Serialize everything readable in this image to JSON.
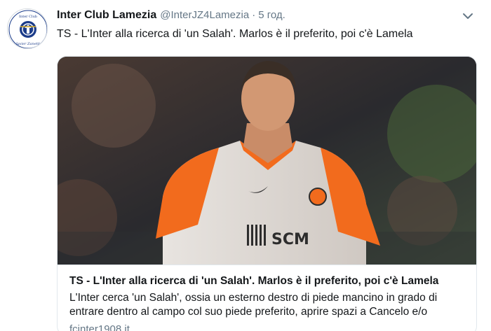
{
  "user": {
    "name": "Inter Club Lamezia",
    "handle": "@InterJZ4Lamezia",
    "separator": "·",
    "time": "5 год.",
    "avatar_text": {
      "top": "Inter Club",
      "bottom": "Javier Zanetti"
    }
  },
  "tweet": {
    "text": "TS - L'Inter alla ricerca di 'un Salah'. Marlos è il preferito, poi c'è Lamela"
  },
  "card": {
    "image_logo_text": "SCM",
    "title": "TS - L'Inter alla ricerca di 'un Salah'. Marlos è il preferito, poi c'è Lamela",
    "description": "L'Inter cerca 'un Salah', ossia un esterno destro di piede mancino in grado di entrare dentro al campo col suo piede preferito, aprire spazi a Cancelo e/o",
    "domain": "fcinter1908.it"
  },
  "icons": {
    "caret": "chevron-down-icon"
  },
  "colors": {
    "text": "#14171a",
    "secondary": "#657786",
    "border": "#e1e8ed",
    "shirt_orange": "#f26b1d"
  }
}
